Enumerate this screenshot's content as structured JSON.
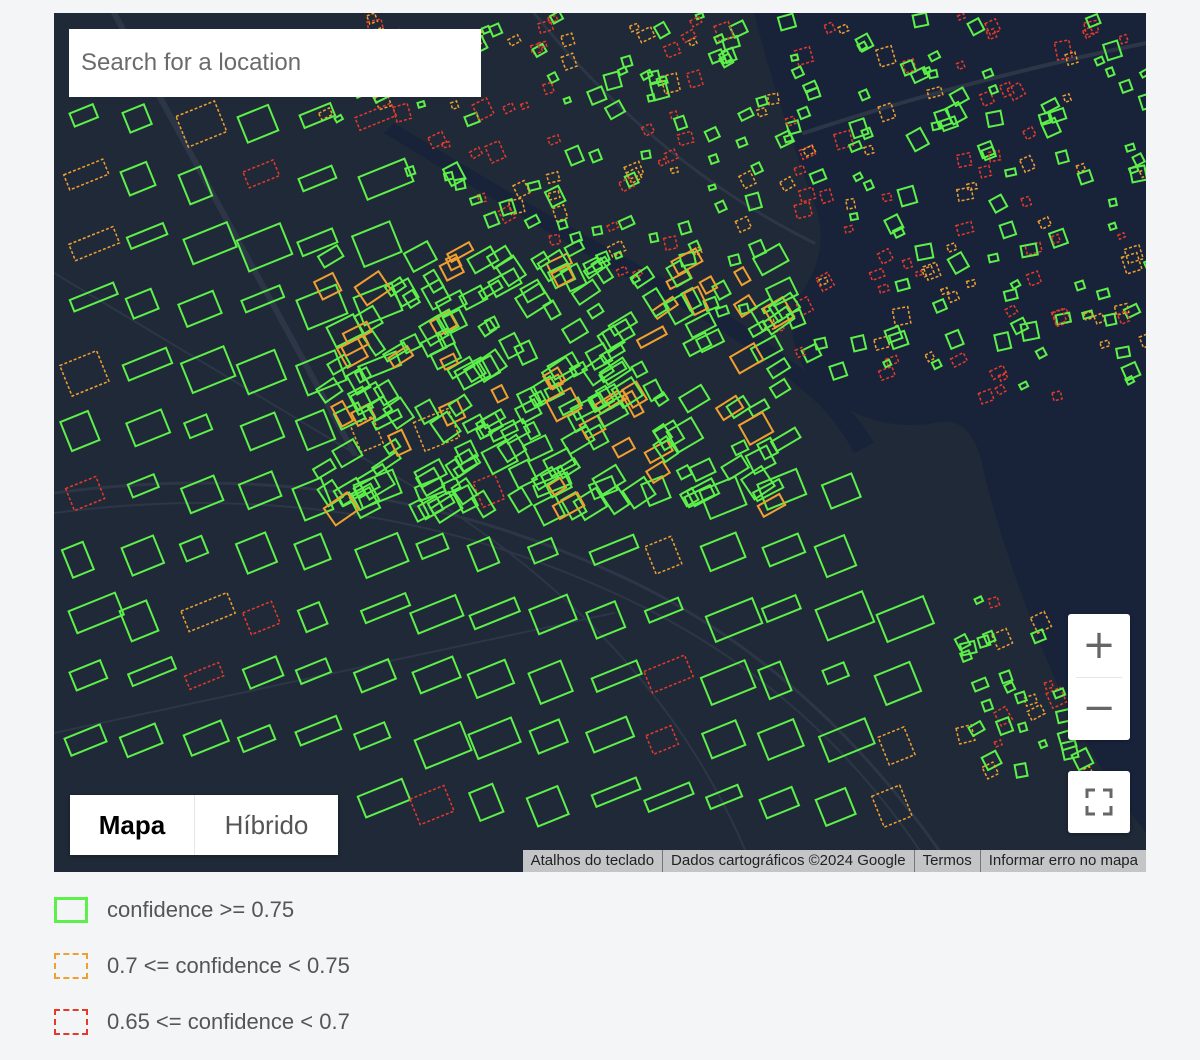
{
  "map": {
    "search": {
      "placeholder": "Search for a location"
    },
    "map_types": [
      {
        "label": "Mapa",
        "selected": true
      },
      {
        "label": "Híbrido",
        "selected": false
      }
    ],
    "zoom": {
      "in_symbol": "+",
      "out_symbol": "−"
    },
    "attribution": [
      "Atalhos do teclado",
      "Dados cartográficos ©2024 Google",
      "Termos",
      "Informar erro no mapa"
    ],
    "colors": {
      "background": "#1f2937",
      "water": "#18233a",
      "road": "#2c3646"
    }
  },
  "legend": [
    {
      "label": "confidence >= 0.75",
      "color": "#5ef04a",
      "style": "solid"
    },
    {
      "label": "0.7 <= confidence < 0.75",
      "color": "#f0a030",
      "style": "dashed"
    },
    {
      "label": "0.65 <= confidence < 0.7",
      "color": "#e53a2a",
      "style": "dashed"
    }
  ]
}
